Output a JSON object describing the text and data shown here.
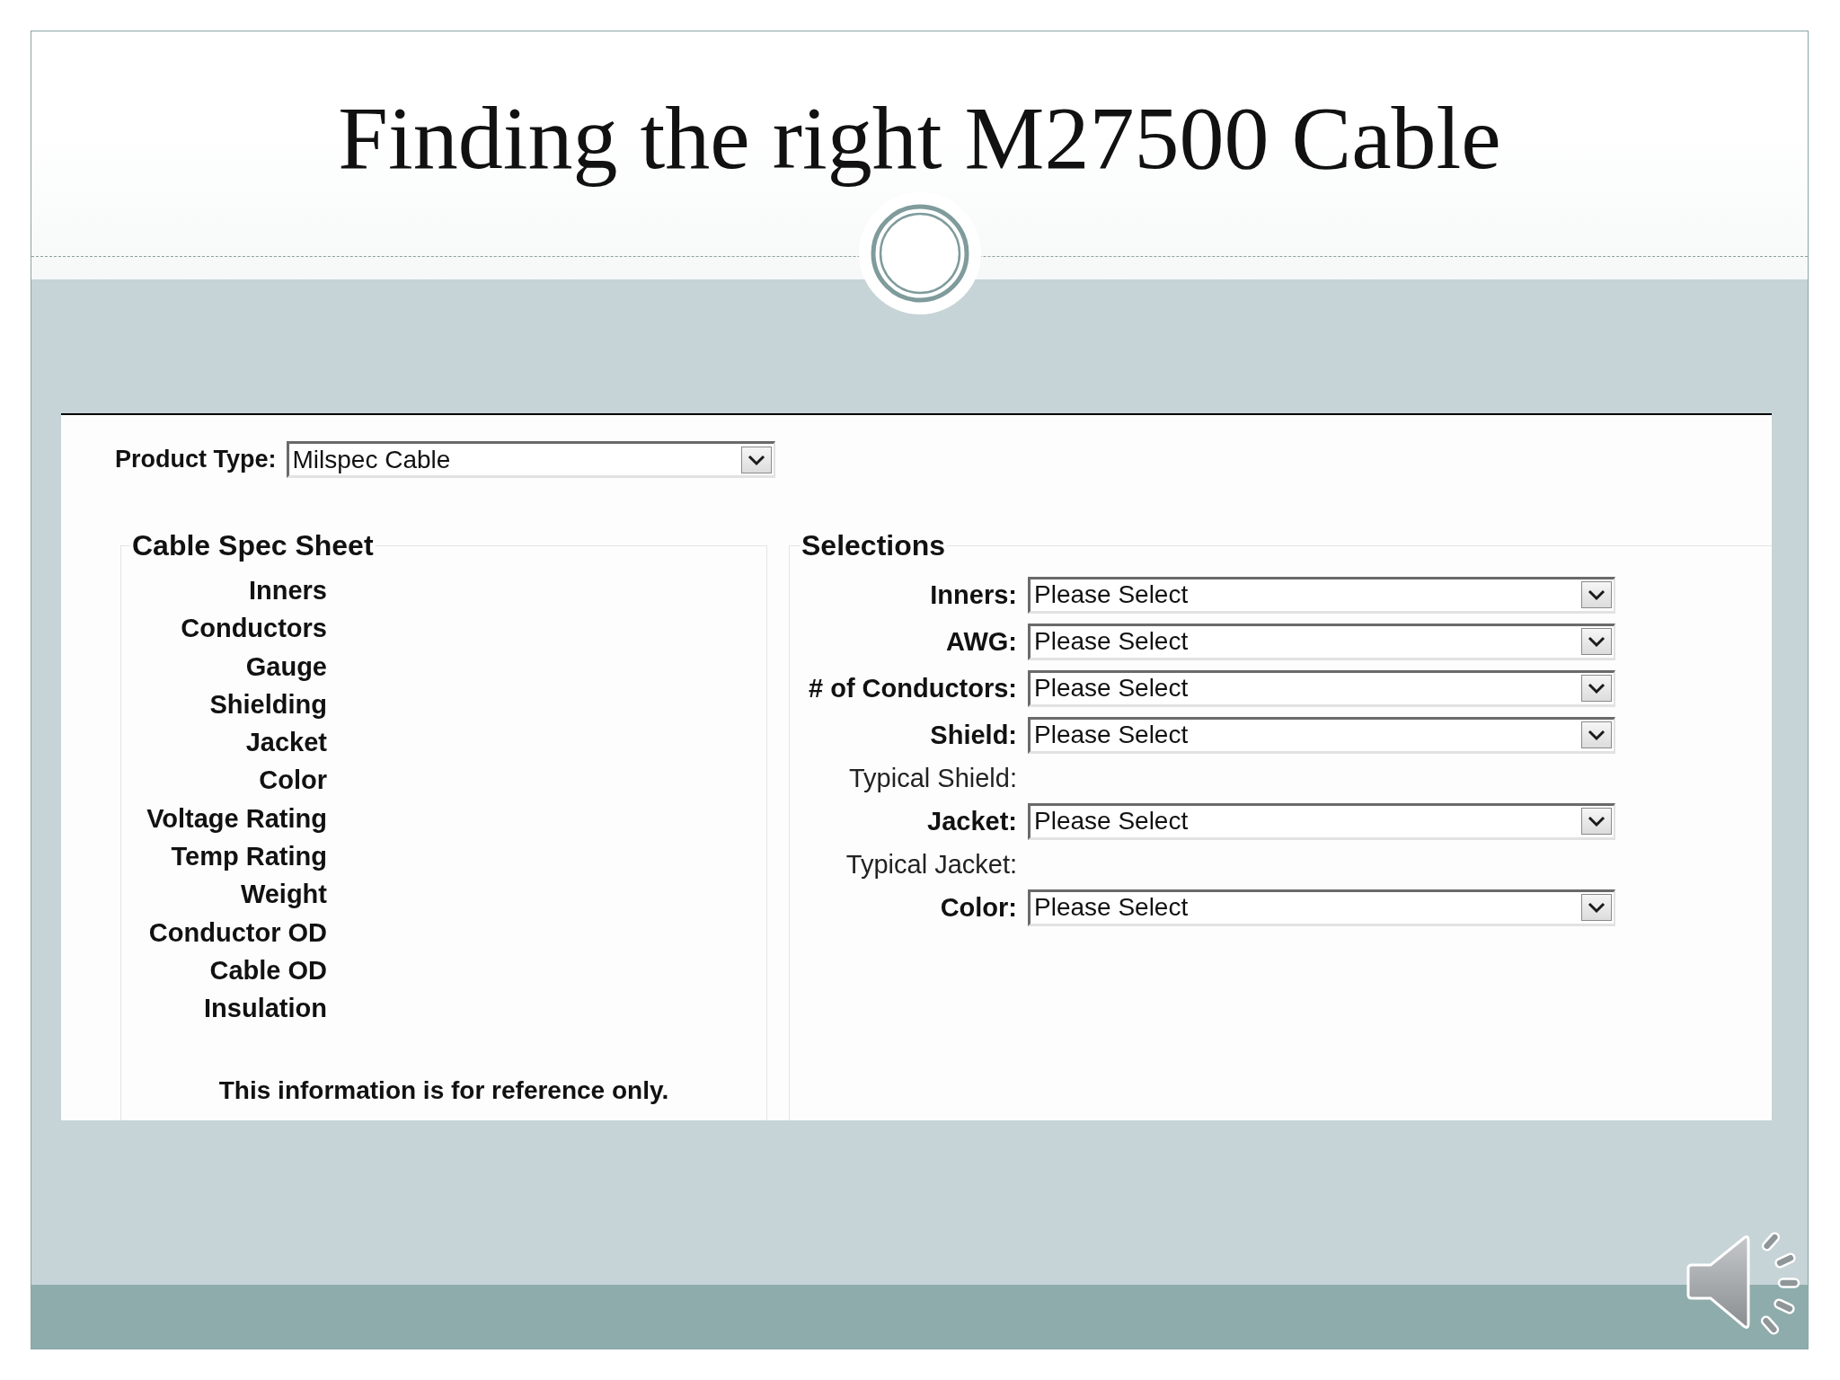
{
  "slide": {
    "title": "Finding the right M27500 Cable"
  },
  "form": {
    "product_type": {
      "label": "Product Type:",
      "value": "Milspec Cable"
    },
    "spec_sheet": {
      "legend": "Cable Spec Sheet",
      "fields": [
        "Inners",
        "Conductors",
        "Gauge",
        "Shielding",
        "Jacket",
        "Color",
        "Voltage Rating",
        "Temp Rating",
        "Weight",
        "Conductor OD",
        "Cable OD",
        "Insulation"
      ],
      "note": "This information is for reference only."
    },
    "selections": {
      "legend": "Selections",
      "rows": [
        {
          "kind": "select",
          "label": "Inners:",
          "value": "Please Select"
        },
        {
          "kind": "select",
          "label": "AWG:",
          "value": "Please Select"
        },
        {
          "kind": "select",
          "label": "# of Conductors:",
          "value": "Please Select"
        },
        {
          "kind": "select",
          "label": "Shield:",
          "value": "Please Select"
        },
        {
          "kind": "info",
          "label": "Typical Shield:"
        },
        {
          "kind": "select",
          "label": "Jacket:",
          "value": "Please Select"
        },
        {
          "kind": "info",
          "label": "Typical Jacket:"
        },
        {
          "kind": "select",
          "label": "Color:",
          "value": "Please Select"
        }
      ]
    }
  }
}
